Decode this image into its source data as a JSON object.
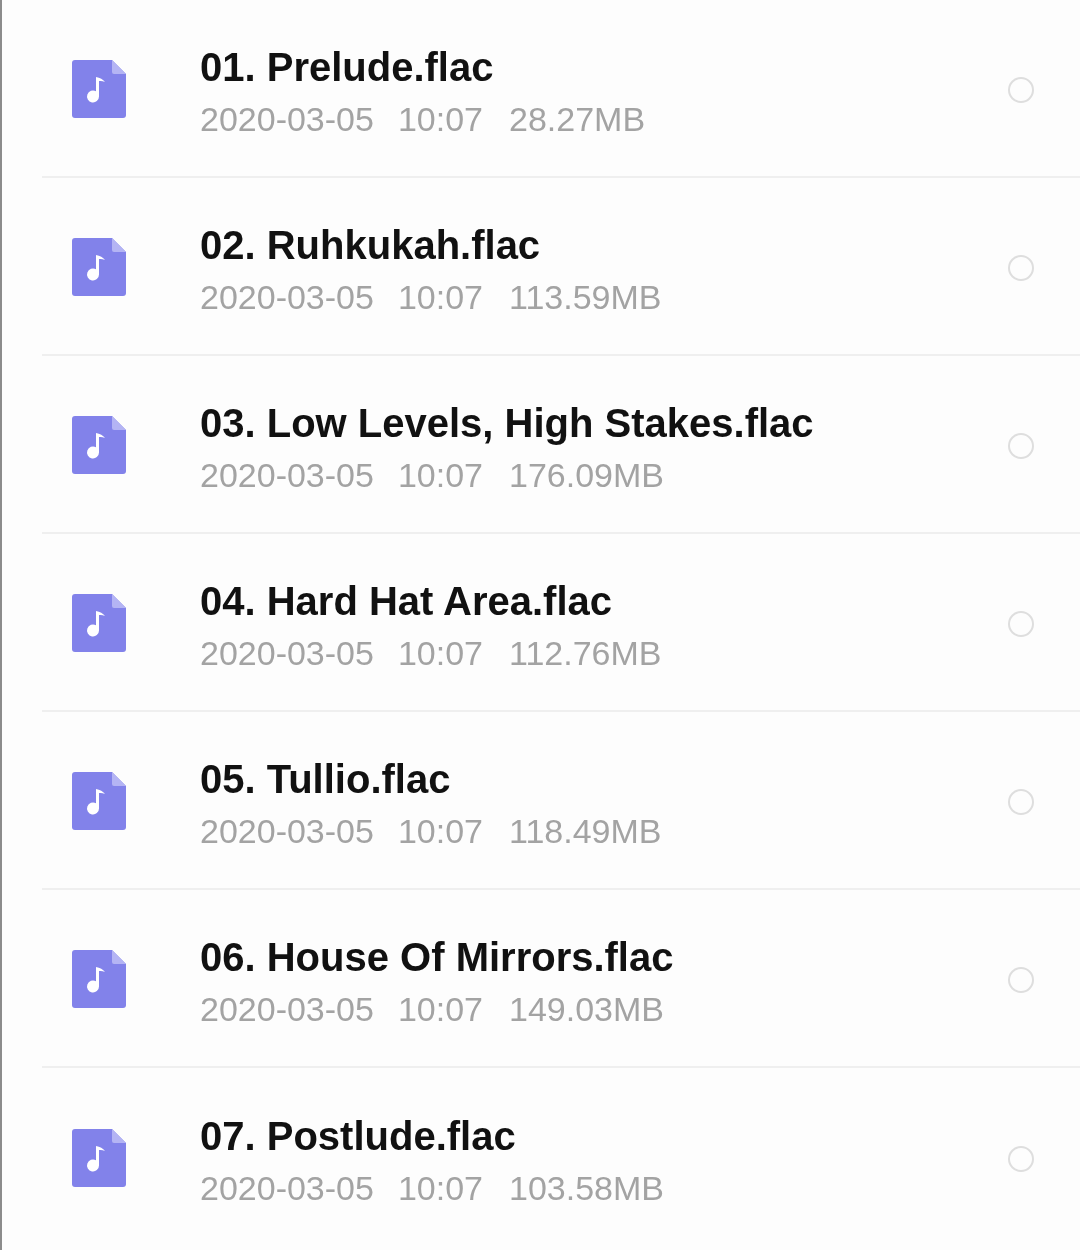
{
  "files": [
    {
      "name": "01. Prelude.flac",
      "date": "2020-03-05",
      "time": "10:07",
      "size": "28.27MB",
      "selected": false
    },
    {
      "name": "02. Ruhkukah.flac",
      "date": "2020-03-05",
      "time": "10:07",
      "size": "113.59MB",
      "selected": false
    },
    {
      "name": "03. Low Levels, High Stakes.flac",
      "date": "2020-03-05",
      "time": "10:07",
      "size": "176.09MB",
      "selected": false
    },
    {
      "name": "04. Hard Hat Area.flac",
      "date": "2020-03-05",
      "time": "10:07",
      "size": "112.76MB",
      "selected": false
    },
    {
      "name": "05. Tullio.flac",
      "date": "2020-03-05",
      "time": "10:07",
      "size": "118.49MB",
      "selected": false
    },
    {
      "name": "06. House Of Mirrors.flac",
      "date": "2020-03-05",
      "time": "10:07",
      "size": "149.03MB",
      "selected": false
    },
    {
      "name": "07. Postlude.flac",
      "date": "2020-03-05",
      "time": "10:07",
      "size": "103.58MB",
      "selected": false
    }
  ]
}
